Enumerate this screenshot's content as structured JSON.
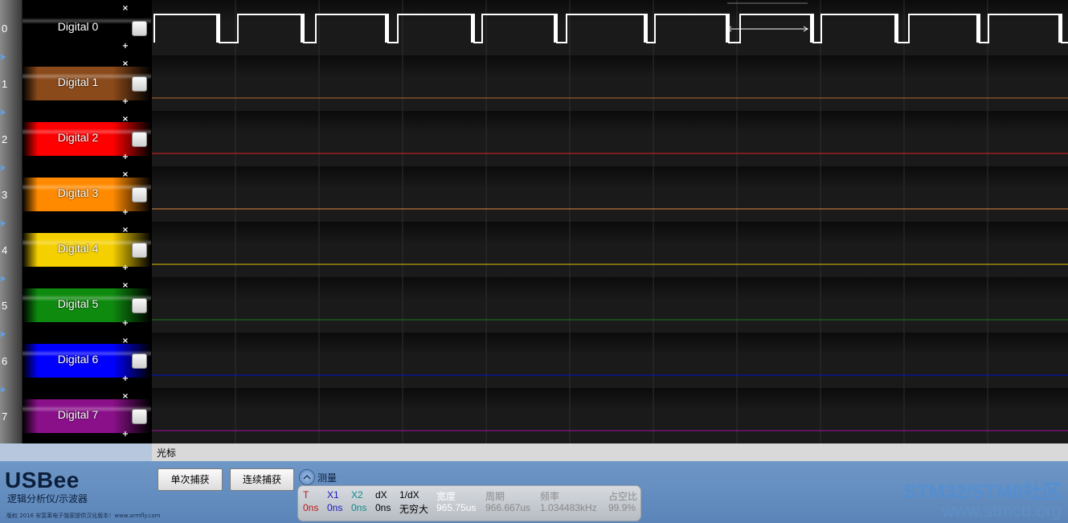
{
  "channels": [
    {
      "num": "0",
      "name": "Digital 0",
      "color": "#000000",
      "trace_color": "#ffffff"
    },
    {
      "num": "1",
      "name": "Digital 1",
      "color": "#8b4a1a",
      "trace_color": "#b06a30"
    },
    {
      "num": "2",
      "name": "Digital 2",
      "color": "#ff0000",
      "trace_color": "#e02020"
    },
    {
      "num": "3",
      "name": "Digital 3",
      "color": "#ff8a00",
      "trace_color": "#e08a40"
    },
    {
      "num": "4",
      "name": "Digital 4",
      "color": "#f5d000",
      "trace_color": "#e0c000"
    },
    {
      "num": "5",
      "name": "Digital 5",
      "color": "#0e8a0e",
      "trace_color": "#1e7a1e"
    },
    {
      "num": "6",
      "name": "Digital 6",
      "color": "#0000ff",
      "trace_color": "#0010d0"
    },
    {
      "num": "7",
      "name": "Digital 7",
      "color": "#8a108a",
      "trace_color": "#a010a0"
    }
  ],
  "digital0_edges": [
    0,
    81,
    104,
    186,
    201,
    291,
    303,
    398,
    408,
    501,
    513,
    613,
    623,
    715,
    729,
    820,
    830,
    925,
    939,
    1027,
    1038,
    1129
  ],
  "cursor_bar": {
    "label": "光标"
  },
  "branding": {
    "logo": "USBee",
    "subtitle": "逻辑分析仪/示波器",
    "copyright": "版权 2016 安富莱电子独家提供汉化版本！www.armfly.com"
  },
  "buttons": {
    "single_capture": "单次捕获",
    "continuous_capture": "连续捕获"
  },
  "measure": {
    "label": "测量",
    "columns": [
      {
        "header": "T",
        "value": "0ns",
        "header_color": "#c01818",
        "value_color": "#c01818"
      },
      {
        "header": "X1",
        "value": "0ns",
        "header_color": "#1818c0",
        "value_color": "#1818c0"
      },
      {
        "header": "X2",
        "value": "0ns",
        "header_color": "#108a8a",
        "value_color": "#108a8a"
      },
      {
        "header": "dX",
        "value": "0ns",
        "header_color": "#000000",
        "value_color": "#000000"
      },
      {
        "header": "1/dX",
        "value": "无穷大",
        "header_color": "#000000",
        "value_color": "#000000"
      },
      {
        "header": "宽度",
        "value": "965.75us",
        "header_color": "#ffffff",
        "value_color": "#ffffff"
      },
      {
        "header": "周期",
        "value": "966.667us",
        "header_color": "#8a8a8a",
        "value_color": "#8a8a8a"
      },
      {
        "header": "频率",
        "value": "1.034483kHz",
        "header_color": "#8a8a8a",
        "value_color": "#8a8a8a"
      },
      {
        "header": "占空比",
        "value": "99.9%",
        "header_color": "#8a8a8a",
        "value_color": "#8a8a8a"
      }
    ]
  },
  "watermark": {
    "line1": "STM32/STM8社区",
    "line2": "www.stmcu.org"
  }
}
